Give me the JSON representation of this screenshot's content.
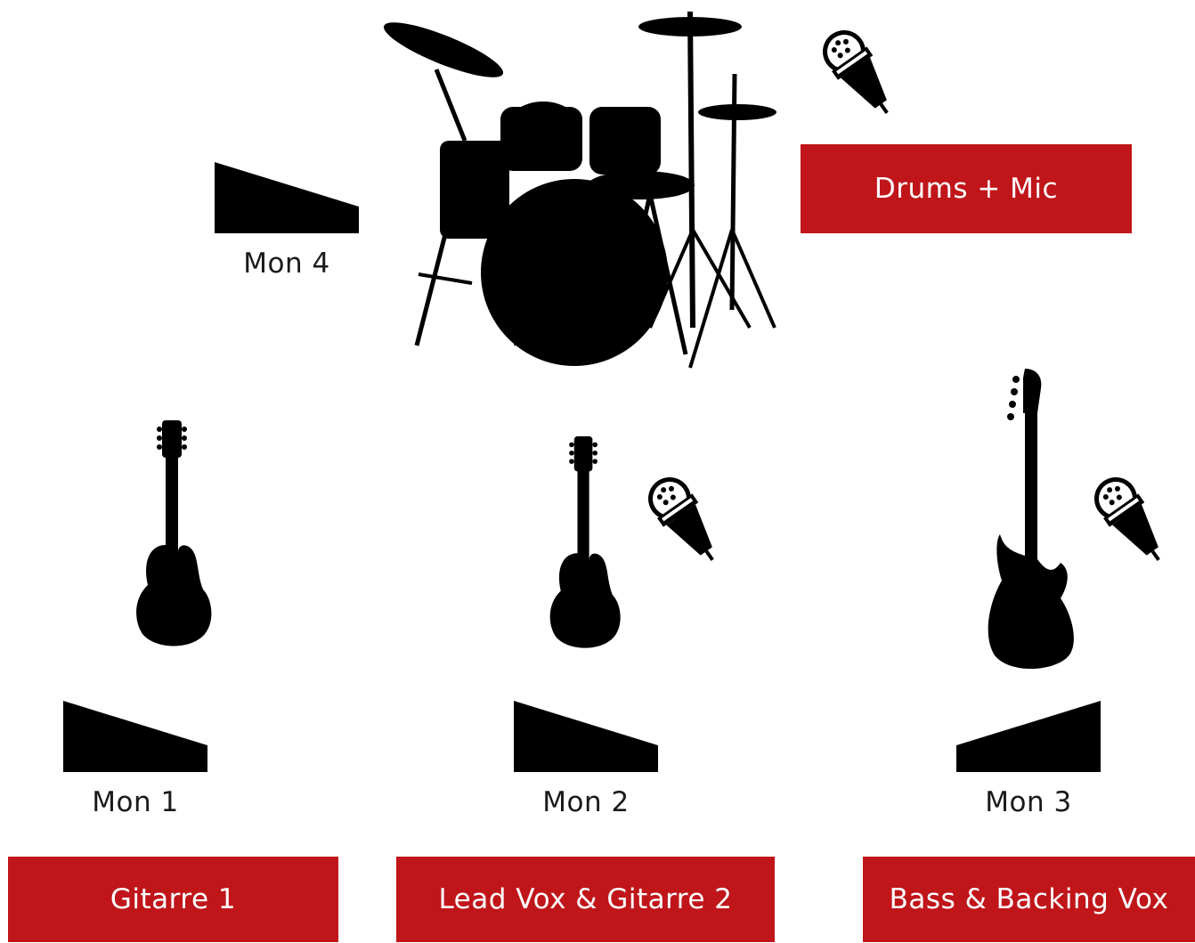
{
  "monitors": {
    "mon1": "Mon 1",
    "mon2": "Mon 2",
    "mon3": "Mon 3",
    "mon4": "Mon 4"
  },
  "positions": {
    "drums": "Drums + Mic",
    "guitar1": "Gitarre 1",
    "lead": "Lead Vox & Gitarre 2",
    "bass": "Bass & Backing Vox"
  },
  "colors": {
    "accent": "#c0161a",
    "silhouette": "#000000"
  },
  "icons": [
    "drum-kit-icon",
    "microphone-icon",
    "electric-guitar-icon",
    "bass-guitar-icon",
    "stage-monitor-icon"
  ]
}
